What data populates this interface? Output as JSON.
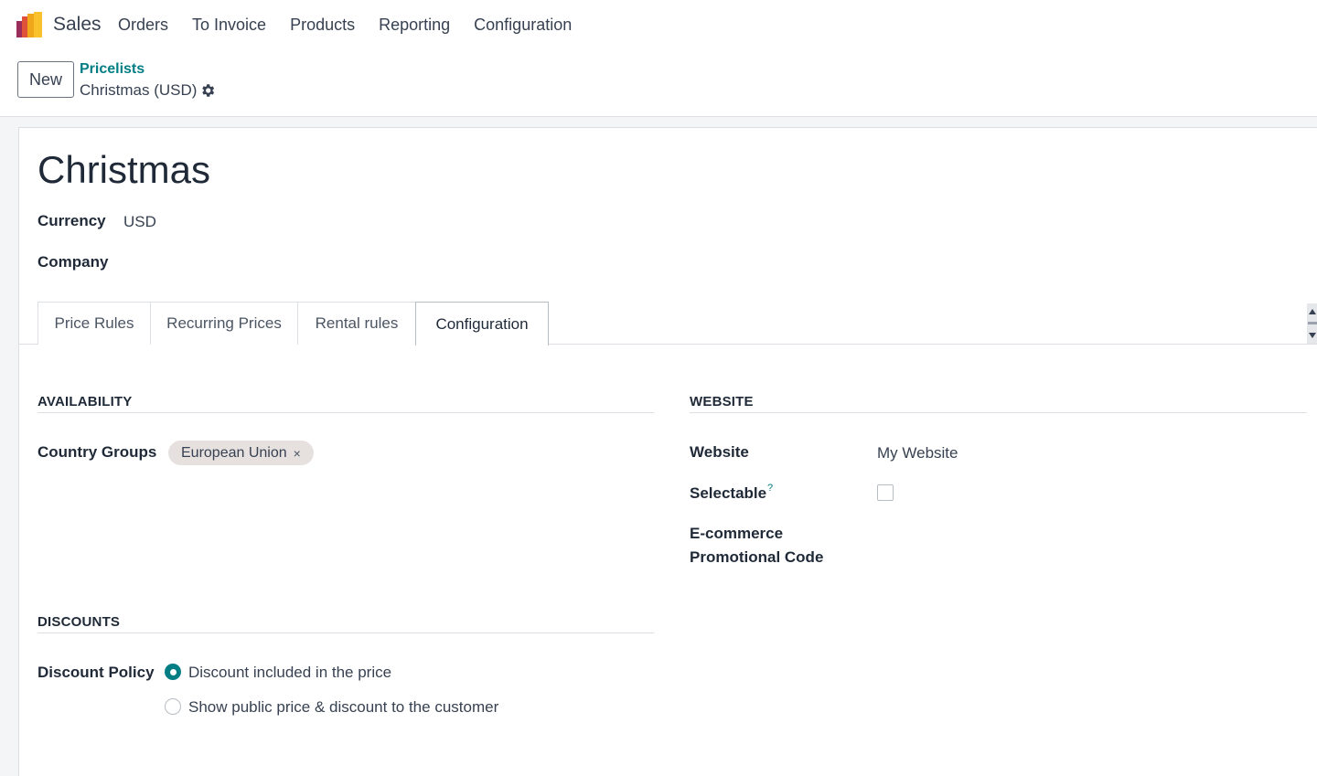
{
  "app": {
    "name": "Sales",
    "menu": [
      "Orders",
      "To Invoice",
      "Products",
      "Reporting",
      "Configuration"
    ]
  },
  "control_panel": {
    "new_label": "New",
    "breadcrumb_parent": "Pricelists",
    "breadcrumb_current": "Christmas (USD)"
  },
  "record": {
    "title": "Christmas",
    "currency_label": "Currency",
    "currency_value": "USD",
    "company_label": "Company"
  },
  "tabs": [
    {
      "label": "Price Rules",
      "active": false
    },
    {
      "label": "Recurring Prices",
      "active": false
    },
    {
      "label": "Rental rules",
      "active": false
    },
    {
      "label": "Configuration",
      "active": true
    }
  ],
  "availability": {
    "title": "AVAILABILITY",
    "country_groups_label": "Country Groups",
    "country_group_tag": "European Union",
    "tag_remove": "×"
  },
  "website": {
    "title": "WEBSITE",
    "website_label": "Website",
    "website_value": "My Website",
    "selectable_label": "Selectable",
    "selectable_help": "?",
    "selectable_checked": false,
    "promo_label_line1": "E-commerce",
    "promo_label_line2": "Promotional Code"
  },
  "discounts": {
    "title": "DISCOUNTS",
    "policy_label": "Discount Policy",
    "options": [
      {
        "label": "Discount included in the price",
        "checked": true
      },
      {
        "label": "Show public price & discount to the customer",
        "checked": false
      }
    ]
  },
  "colors": {
    "accent": "#017e84",
    "tag_bg": "#e6e1df"
  }
}
